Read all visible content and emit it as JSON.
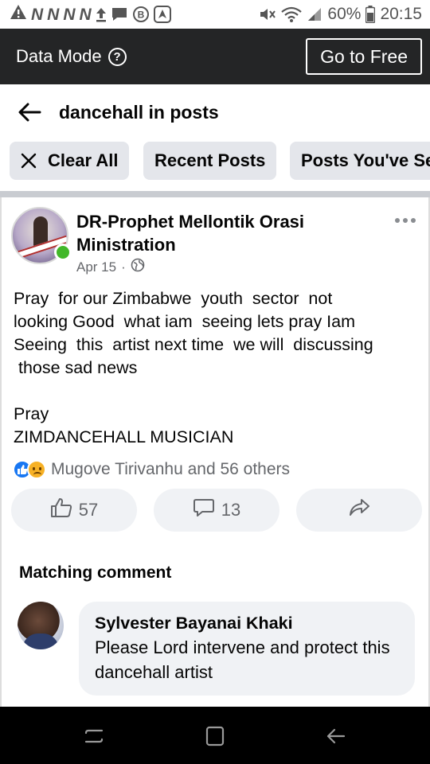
{
  "status_bar": {
    "left_icons": [
      "warning-icon",
      "n-app-icon",
      "n-app-icon",
      "n-app-icon",
      "n-app-icon",
      "upload-icon",
      "message-icon",
      "b-circle-icon",
      "navigation-icon"
    ],
    "battery": "60%",
    "time": "20:15"
  },
  "data_bar": {
    "label": "Data Mode",
    "button": "Go to Free",
    "background": "#242526"
  },
  "search": {
    "query": "dancehall in posts"
  },
  "filters": [
    {
      "label": "Clear All",
      "icon": "close-icon"
    },
    {
      "label": "Recent Posts"
    },
    {
      "label": "Posts You've Seen"
    }
  ],
  "post": {
    "author": "DR-Prophet Mellontik Orasi Ministration",
    "date": "Apr 15",
    "separator": "·",
    "audience_icon": "globe-icon",
    "body_lines": [
      "Pray  for our Zimbabwe  youth  sector  not",
      "looking Good  what iam  seeing lets pray Iam",
      "Seeing  this  artist next time  we will  discussing",
      " those sad news",
      "",
      "Pray",
      "ZIMDANCEHALL MUSICIAN"
    ],
    "reactions_text": "Mugove Tirivanhu and 56 others",
    "likes": "57",
    "comments": "13",
    "online_color": "#42b72a"
  },
  "matching_comment": {
    "heading": "Matching comment",
    "author": "Sylvester Bayanai Khaki",
    "text": "Please Lord intervene and protect this dancehall artist"
  },
  "colors": {
    "accent": "#1877f2",
    "chip_bg": "#e4e6eb",
    "muted_text": "#65676b"
  }
}
